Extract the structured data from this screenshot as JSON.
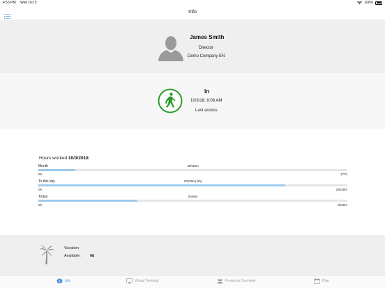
{
  "status_bar": {
    "time": "4:53 PM",
    "date": "Wed Oct 3",
    "battery": "100%"
  },
  "nav": {
    "title": "Info"
  },
  "profile": {
    "name": "James Smith",
    "role": "Director",
    "company": "Demo Company EN"
  },
  "presence": {
    "status": "In",
    "datetime": "10/3/18, 8:06 AM",
    "caption": "Last access",
    "color": "#2a9a2a"
  },
  "hours": {
    "title_prefix": "Hours worked",
    "title_date": "10/3/2018",
    "rows": [
      {
        "label": "Month",
        "value": "20h30m",
        "min": "0h",
        "max": "177h",
        "progress": 0.12
      },
      {
        "label": "To this day",
        "value": "20h30m(-5h)",
        "min": "0h",
        "max": "25h30m",
        "progress": 0.8
      },
      {
        "label": "Today",
        "value": "2h45m",
        "min": "0h",
        "max": "8h30m",
        "progress": 0.32
      }
    ]
  },
  "vacation": {
    "title": "Vacation",
    "available_label": "Available:",
    "available_value": "0d"
  },
  "tabs": [
    {
      "label": "Info",
      "icon": "info-circle-icon",
      "active": true
    },
    {
      "label": "Virtual Terminal",
      "icon": "monitor-icon",
      "active": false
    },
    {
      "label": "Presence Overview",
      "icon": "people-icon",
      "active": false
    },
    {
      "label": "Plan",
      "icon": "calendar-icon",
      "active": false
    }
  ],
  "colors": {
    "accent": "#4a90d9",
    "progress_fill": "#9ccbec",
    "track": "#e6e6e6"
  }
}
